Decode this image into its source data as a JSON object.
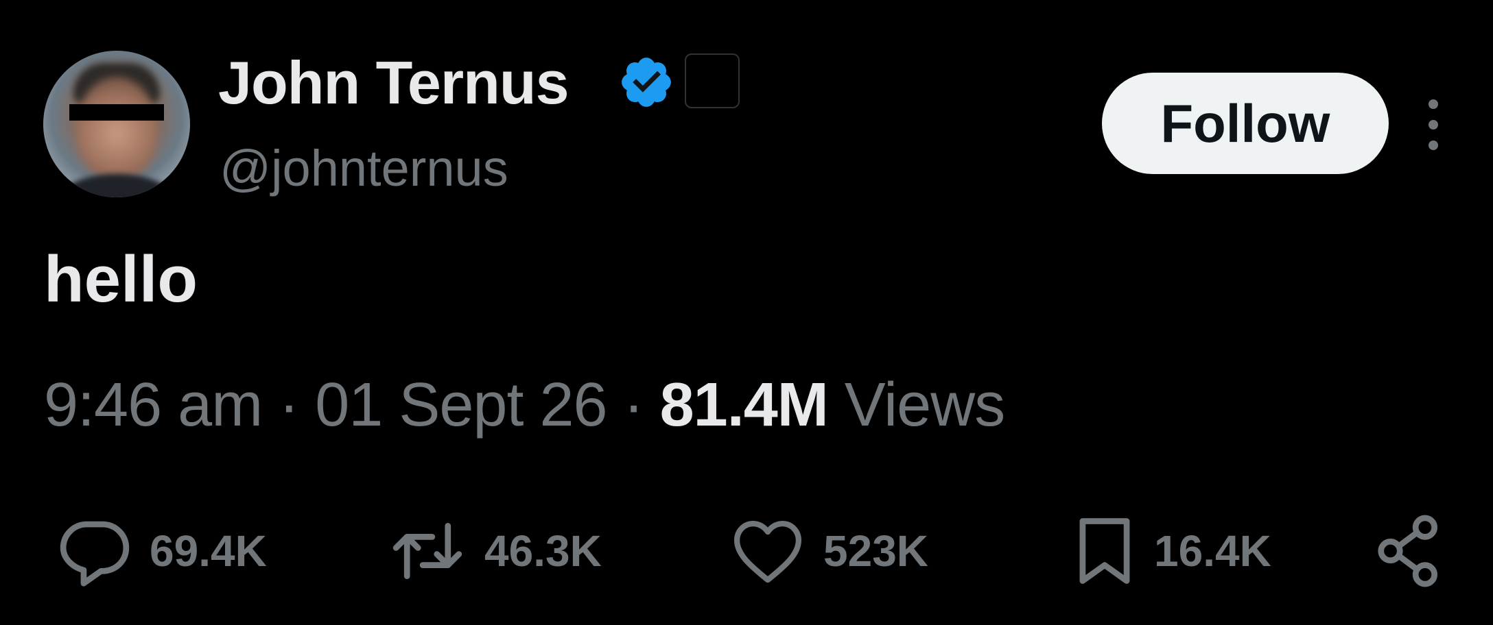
{
  "author": {
    "display_name": "John Ternus",
    "handle": "@johnternus",
    "verified_icon": "verified-badge-icon",
    "verified_color": "#1d9bf0"
  },
  "header": {
    "follow_label": "Follow",
    "more_icon": "more-vertical-icon"
  },
  "tweet": {
    "text": "hello",
    "time": "9:46 am",
    "date": "01 Sept 26",
    "separator": "·",
    "views_count": "81.4M",
    "views_label": "Views"
  },
  "actions": {
    "reply_count": "69.4K",
    "retweet_count": "46.3K",
    "like_count": "523K",
    "bookmark_count": "16.4K"
  },
  "colors": {
    "background": "#000000",
    "primary_text": "#e7e9ea",
    "secondary_text": "#71767b",
    "button_bg": "#eff3f4"
  }
}
